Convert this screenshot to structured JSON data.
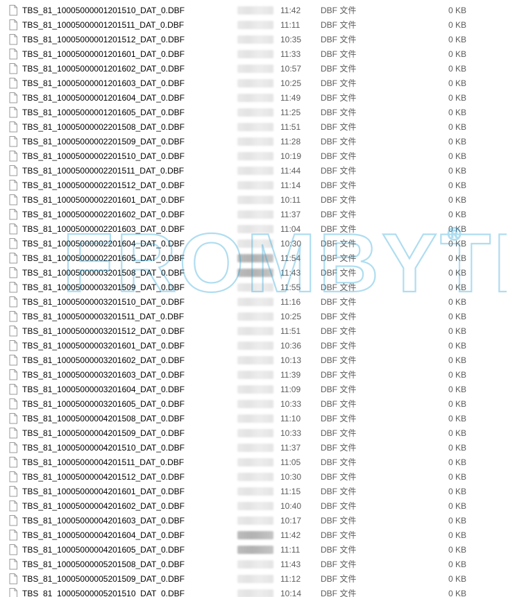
{
  "file_type_label": "DBF 文件",
  "size_label": "0 KB",
  "files": [
    {
      "name": "TBS_81_10005000001201510_DAT_0.DBF",
      "time": "11:42",
      "dark": false
    },
    {
      "name": "TBS_81_10005000001201511_DAT_0.DBF",
      "time": "11:11",
      "dark": false
    },
    {
      "name": "TBS_81_10005000001201512_DAT_0.DBF",
      "time": "10:35",
      "dark": false
    },
    {
      "name": "TBS_81_10005000001201601_DAT_0.DBF",
      "time": "11:33",
      "dark": false
    },
    {
      "name": "TBS_81_10005000001201602_DAT_0.DBF",
      "time": "10:57",
      "dark": false
    },
    {
      "name": "TBS_81_10005000001201603_DAT_0.DBF",
      "time": "10:25",
      "dark": false
    },
    {
      "name": "TBS_81_10005000001201604_DAT_0.DBF",
      "time": "11:49",
      "dark": false
    },
    {
      "name": "TBS_81_10005000001201605_DAT_0.DBF",
      "time": "11:25",
      "dark": false
    },
    {
      "name": "TBS_81_10005000002201508_DAT_0.DBF",
      "time": "11:51",
      "dark": false
    },
    {
      "name": "TBS_81_10005000002201509_DAT_0.DBF",
      "time": "11:28",
      "dark": false
    },
    {
      "name": "TBS_81_10005000002201510_DAT_0.DBF",
      "time": "10:19",
      "dark": false
    },
    {
      "name": "TBS_81_10005000002201511_DAT_0.DBF",
      "time": "11:44",
      "dark": false
    },
    {
      "name": "TBS_81_10005000002201512_DAT_0.DBF",
      "time": "11:14",
      "dark": false
    },
    {
      "name": "TBS_81_10005000002201601_DAT_0.DBF",
      "time": "10:11",
      "dark": false
    },
    {
      "name": "TBS_81_10005000002201602_DAT_0.DBF",
      "time": "11:37",
      "dark": false
    },
    {
      "name": "TBS_81_10005000002201603_DAT_0.DBF",
      "time": "11:04",
      "dark": false
    },
    {
      "name": "TBS_81_10005000002201604_DAT_0.DBF",
      "time": "10:30",
      "dark": false
    },
    {
      "name": "TBS_81_10005000002201605_DAT_0.DBF",
      "time": "11:54",
      "dark": true
    },
    {
      "name": "TBS_81_10005000003201508_DAT_0.DBF",
      "time": "11:43",
      "dark": true
    },
    {
      "name": "TBS_81_10005000003201509_DAT_0.DBF",
      "time": "11:55",
      "dark": false
    },
    {
      "name": "TBS_81_10005000003201510_DAT_0.DBF",
      "time": "11:16",
      "dark": false
    },
    {
      "name": "TBS_81_10005000003201511_DAT_0.DBF",
      "time": "10:25",
      "dark": false
    },
    {
      "name": "TBS_81_10005000003201512_DAT_0.DBF",
      "time": "11:51",
      "dark": false
    },
    {
      "name": "TBS_81_10005000003201601_DAT_0.DBF",
      "time": "10:36",
      "dark": false
    },
    {
      "name": "TBS_81_10005000003201602_DAT_0.DBF",
      "time": "10:13",
      "dark": false
    },
    {
      "name": "TBS_81_10005000003201603_DAT_0.DBF",
      "time": "11:39",
      "dark": false
    },
    {
      "name": "TBS_81_10005000003201604_DAT_0.DBF",
      "time": "11:09",
      "dark": false
    },
    {
      "name": "TBS_81_10005000003201605_DAT_0.DBF",
      "time": "10:33",
      "dark": false
    },
    {
      "name": "TBS_81_10005000004201508_DAT_0.DBF",
      "time": "11:10",
      "dark": false
    },
    {
      "name": "TBS_81_10005000004201509_DAT_0.DBF",
      "time": "10:33",
      "dark": false
    },
    {
      "name": "TBS_81_10005000004201510_DAT_0.DBF",
      "time": "11:37",
      "dark": false
    },
    {
      "name": "TBS_81_10005000004201511_DAT_0.DBF",
      "time": "11:05",
      "dark": false
    },
    {
      "name": "TBS_81_10005000004201512_DAT_0.DBF",
      "time": "10:30",
      "dark": false
    },
    {
      "name": "TBS_81_10005000004201601_DAT_0.DBF",
      "time": "11:15",
      "dark": false
    },
    {
      "name": "TBS_81_10005000004201602_DAT_0.DBF",
      "time": "10:40",
      "dark": false
    },
    {
      "name": "TBS_81_10005000004201603_DAT_0.DBF",
      "time": "10:17",
      "dark": false
    },
    {
      "name": "TBS_81_10005000004201604_DAT_0.DBF",
      "time": "11:42",
      "dark": true
    },
    {
      "name": "TBS_81_10005000004201605_DAT_0.DBF",
      "time": "11:11",
      "dark": true
    },
    {
      "name": "TBS_81_10005000005201508_DAT_0.DBF",
      "time": "11:43",
      "dark": false
    },
    {
      "name": "TBS_81_10005000005201509_DAT_0.DBF",
      "time": "11:12",
      "dark": false
    },
    {
      "name": "TBS_81_10005000005201510_DAT_0.DBF",
      "time": "10:14",
      "dark": false
    }
  ],
  "watermark_text": "FROMBYTE",
  "watermark_r": "®"
}
